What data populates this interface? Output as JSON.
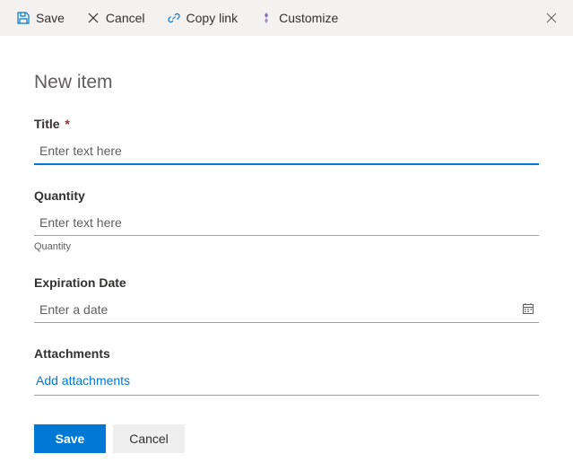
{
  "toolbar": {
    "save_label": "Save",
    "cancel_label": "Cancel",
    "copylink_label": "Copy link",
    "customize_label": "Customize"
  },
  "page": {
    "title": "New item"
  },
  "fields": {
    "title": {
      "label": "Title",
      "required_marker": "*",
      "placeholder": "Enter text here",
      "value": ""
    },
    "quantity": {
      "label": "Quantity",
      "placeholder": "Enter text here",
      "value": "",
      "helper": "Quantity"
    },
    "expiration": {
      "label": "Expiration Date",
      "placeholder": "Enter a date",
      "value": ""
    },
    "attachments": {
      "label": "Attachments",
      "add_label": "Add attachments"
    }
  },
  "footer": {
    "save_label": "Save",
    "cancel_label": "Cancel"
  },
  "colors": {
    "accent": "#0078d4",
    "link": "#0078d4",
    "customize": "#8764b8",
    "required": "#a4262c"
  }
}
